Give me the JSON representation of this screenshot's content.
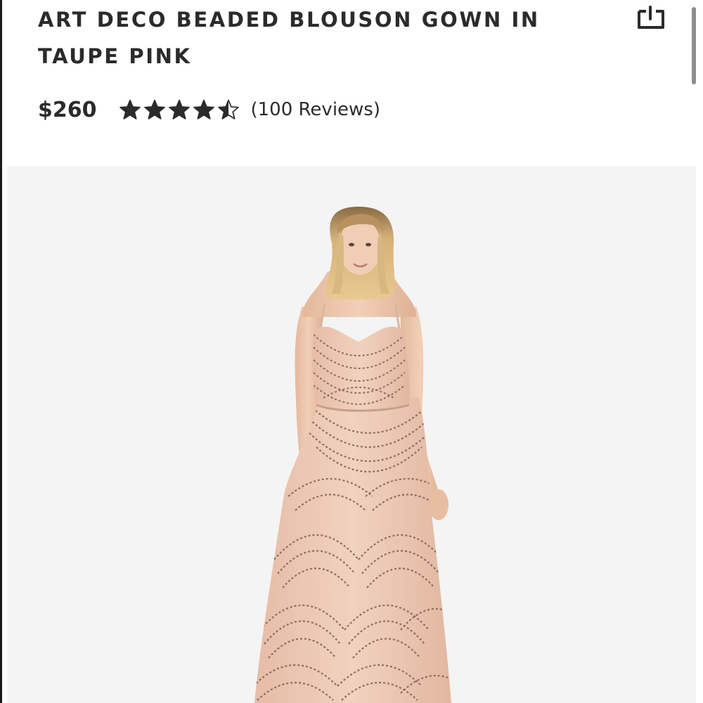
{
  "product": {
    "title": "ART DECO BEADED BLOUSON GOWN IN TAUPE PINK",
    "price": "$260",
    "rating": 4.5,
    "rating_max": 5,
    "reviews_label": "(100 Reviews)"
  },
  "icons": {
    "save": "bookmark-icon",
    "star": "star-icon"
  },
  "colors": {
    "text": "#2b2b2b",
    "panel_background": "#f4f4f4",
    "dress": "#ecc4ad",
    "beading": "#7a5e52"
  }
}
